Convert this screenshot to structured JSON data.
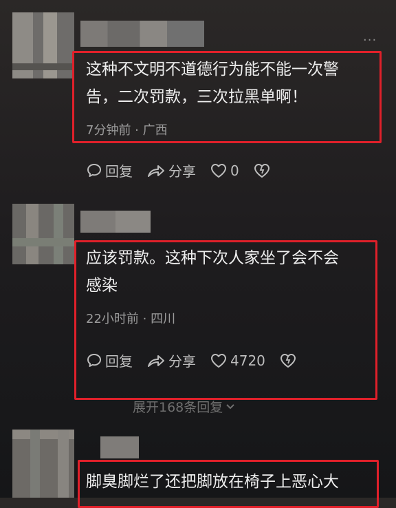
{
  "comments": [
    {
      "text_lines": [
        "这种不文明不道德行为能不能一次警",
        "告，二次罚款，三次拉黑单啊！"
      ],
      "meta": "7分钟前 · 广西",
      "actions": {
        "reply": "回复",
        "share": "分享",
        "likes": "0"
      }
    },
    {
      "text_lines": [
        "应该罚款。这种下次人家坐了会不会",
        "感染"
      ],
      "meta": "22小时前 · 四川",
      "actions": {
        "reply": "回复",
        "share": "分享",
        "likes": "4720"
      }
    },
    {
      "text_lines": [
        "脚臭脚烂了还把脚放在椅子上恶心大"
      ]
    }
  ],
  "expand_replies": "展开168条回复",
  "more_label": "···",
  "colors": {
    "highlight": "#e0202a",
    "background": "#1f1d1f"
  },
  "icons": [
    "chat-bubble-icon",
    "share-arrow-icon",
    "heart-icon",
    "broken-heart-icon",
    "more-dots-icon",
    "chevron-down-icon"
  ]
}
